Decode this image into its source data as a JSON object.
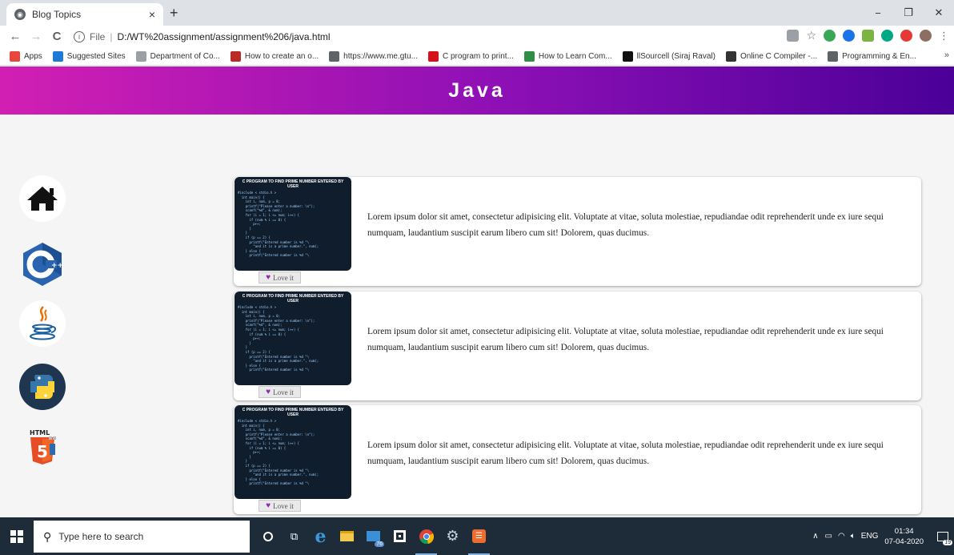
{
  "browser": {
    "tab_title": "Blog Topics",
    "tab_close": "×",
    "new_tab": "+",
    "window_controls": {
      "minimize": "−",
      "restore": "❐",
      "close": "✕"
    },
    "nav": {
      "back": "←",
      "forward": "→",
      "reload": "C"
    },
    "address": {
      "scheme": "File",
      "separator": "|",
      "url": "D:/WT%20assignment/assignment%206/java.html"
    },
    "bookmarks": [
      {
        "label": "Apps",
        "icon": "apps-grid-icon",
        "color": "#e8453c"
      },
      {
        "label": "Suggested Sites",
        "icon": "bing-icon",
        "color": "#1e7ad6"
      },
      {
        "label": "Department of Co...",
        "icon": "globe-icon",
        "color": "#9aa0a6"
      },
      {
        "label": "How to create an o...",
        "icon": "quora-icon",
        "color": "#b92b27"
      },
      {
        "label": "https://www.me.gtu...",
        "icon": "globe-icon",
        "color": "#5f6368"
      },
      {
        "label": "C program to print...",
        "icon": "java-cup-icon",
        "color": "#d4121b"
      },
      {
        "label": "How to Learn Com...",
        "icon": "geeks-icon",
        "color": "#2f8d46"
      },
      {
        "label": "llSourcell (Siraj Raval)",
        "icon": "github-icon",
        "color": "#111111"
      },
      {
        "label": "Online C Compiler -...",
        "icon": "compiler-icon",
        "color": "#333333"
      },
      {
        "label": "Programming & En...",
        "icon": "globe-icon",
        "color": "#5f6368"
      }
    ],
    "bookmarks_more": "»"
  },
  "page": {
    "title": "Java",
    "sidebar": [
      {
        "name": "home",
        "icon": "home-icon"
      },
      {
        "name": "cpp",
        "icon": "cpp-logo-icon"
      },
      {
        "name": "java",
        "icon": "java-logo-icon"
      },
      {
        "name": "python",
        "icon": "python-logo-icon"
      },
      {
        "name": "html5",
        "icon": "html5-logo-icon"
      }
    ],
    "cards": [
      {
        "thumb_title": "C PROGRAM TO FIND PRIME NUMBER ENTERED BY USER",
        "button": "Love it",
        "text": "Lorem ipsum dolor sit amet, consectetur adipisicing elit. Voluptate at vitae, soluta molestiae, repudiandae odit reprehenderit unde ex iure sequi numquam, laudantium suscipit earum libero cum sit! Dolorem, quas ducimus."
      },
      {
        "thumb_title": "C PROGRAM TO FIND PRIME NUMBER ENTERED BY USER",
        "button": "Love it",
        "text": "Lorem ipsum dolor sit amet, consectetur adipisicing elit. Voluptate at vitae, soluta molestiae, repudiandae odit reprehenderit unde ex iure sequi numquam, laudantium suscipit earum libero cum sit! Dolorem, quas ducimus."
      },
      {
        "thumb_title": "C PROGRAM TO FIND PRIME NUMBER ENTERED BY USER",
        "button": "Love it",
        "text": "Lorem ipsum dolor sit amet, consectetur adipisicing elit. Voluptate at vitae, soluta molestiae, repudiandae odit reprehenderit unde ex iure sequi numquam, laudantium suscipit earum libero cum sit! Dolorem, quas ducimus."
      }
    ]
  },
  "taskbar": {
    "search_placeholder": "Type here to search",
    "language": "ENG",
    "time": "01:34",
    "date": "07-04-2020",
    "notification_count": "19",
    "badge_count": "76"
  },
  "colors": {
    "header_gradient_start": "#d21fb3",
    "header_gradient_end": "#4b0098",
    "taskbar": "#1e2b38",
    "heart": "#8e2bb5"
  }
}
